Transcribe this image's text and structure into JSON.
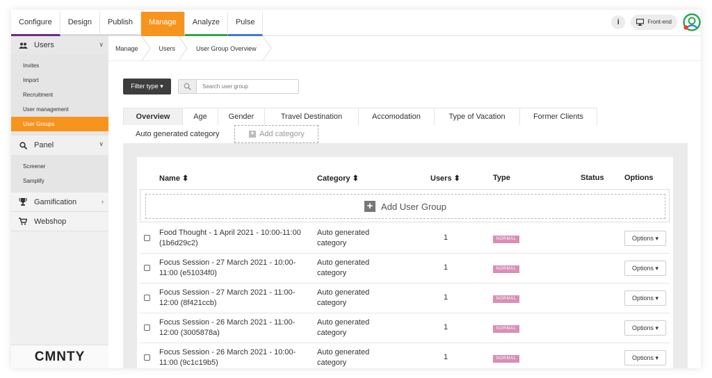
{
  "topnav": {
    "tabs": [
      "Configure",
      "Design",
      "Publish",
      "Manage",
      "Analyze",
      "Pulse"
    ],
    "active_tab": "Manage",
    "info_label": "i",
    "frontend_label": "Front-end"
  },
  "sidebar": {
    "users_label": "Users",
    "users_items": [
      "Invites",
      "Import",
      "Recruitment",
      "User management",
      "User Groups"
    ],
    "active_item": "User Groups",
    "panel_label": "Panel",
    "panel_items": [
      "Screener",
      "Samplify"
    ],
    "gamification_label": "Gamification",
    "webshop_label": "Webshop",
    "logo_text": "CMNTY"
  },
  "breadcrumb": [
    "Manage",
    "Users",
    "User Group Overview"
  ],
  "toolbar": {
    "filter_label": "Filter type ▾",
    "search_placeholder": "Search user group"
  },
  "tabs": {
    "row1": [
      "Overview",
      "Age",
      "Gender",
      "Travel Destination",
      "Accomodation",
      "Type of Vacation",
      "Former Clients"
    ],
    "active": "Overview",
    "row2": [
      "Auto generated category"
    ],
    "add_category_label": "Add category"
  },
  "table": {
    "headers": {
      "name": "Name ⬍",
      "category": "Category ⬍",
      "users": "Users ⬍",
      "type": "Type",
      "status": "Status",
      "options": "Options"
    },
    "add_group_label": "Add User Group",
    "rows": [
      {
        "name": "Food Thought - 1 April 2021 - 10:00-11:00 (1b6d29c2)",
        "category": "Auto generated category",
        "users": "1",
        "type": "NORMAL",
        "options": "Options ▾"
      },
      {
        "name": "Focus Session - 27 March 2021 - 10:00-11:00 (e51034f0)",
        "category": "Auto generated category",
        "users": "1",
        "type": "NORMAL",
        "options": "Options ▾"
      },
      {
        "name": "Focus Session - 27 March 2021 - 11:00-12:00 (8f421ccb)",
        "category": "Auto generated category",
        "users": "1",
        "type": "NORMAL",
        "options": "Options ▾"
      },
      {
        "name": "Focus Session - 26 March 2021 - 11:00-12:00 (3005878a)",
        "category": "Auto generated category",
        "users": "1",
        "type": "NORMAL",
        "options": "Options ▾"
      },
      {
        "name": "Focus Session - 26 March 2021 - 10:00-11:00 (9c1c19b5)",
        "category": "Auto generated category",
        "users": "1",
        "type": "NORMAL",
        "options": "Options ▾"
      }
    ]
  },
  "colors": {
    "accent": "#f7941d",
    "badge": "#d98fb5",
    "dark_button": "#3d3d3d"
  }
}
